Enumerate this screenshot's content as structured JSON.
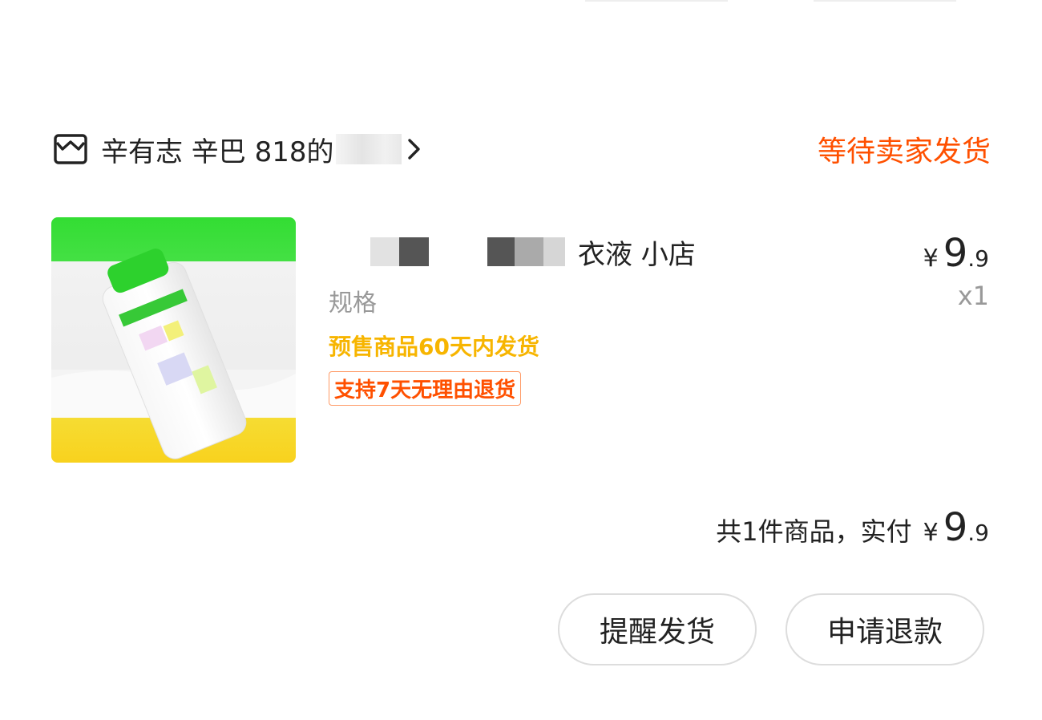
{
  "order": {
    "shop_name": "辛有志 辛巴 818的",
    "shop_icon": "store-icon",
    "chevron_icon": "chevron-right-icon",
    "status": "等待卖家发货",
    "status_color": "#ff5000"
  },
  "product": {
    "title_visible": "衣液 小店",
    "spec_label": "规格",
    "presale_notice": "预售商品60天内发货",
    "return_policy_badge": "支持7天无理由退货",
    "price": {
      "currency": "¥",
      "integer": "9",
      "decimal": ".9"
    },
    "quantity": "x1"
  },
  "summary": {
    "label": "共1件商品，实付",
    "price": {
      "currency": "¥",
      "integer": "9",
      "decimal": ".9"
    }
  },
  "actions": {
    "remind_shipping": "提醒发货",
    "request_refund": "申请退款"
  },
  "colors": {
    "accent": "#ff5000",
    "presale": "#f7b500",
    "muted": "#999999"
  }
}
